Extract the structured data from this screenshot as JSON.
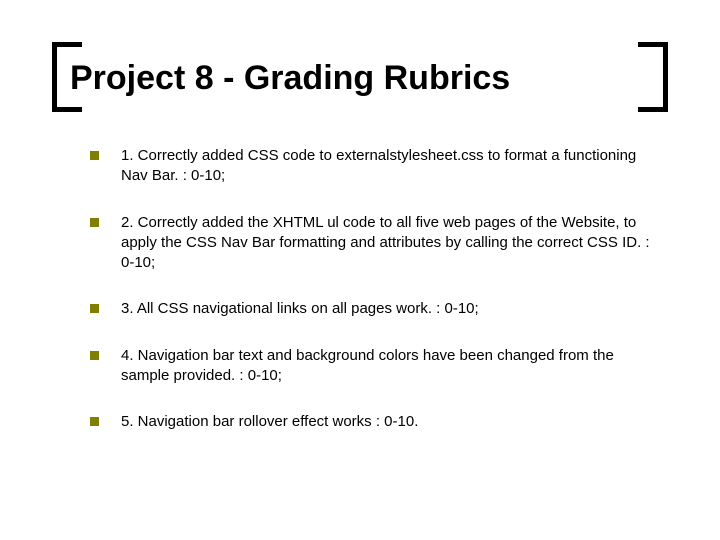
{
  "title": "Project 8 - Grading Rubrics",
  "bullets": [
    {
      "text": "1. Correctly added CSS code to externalstylesheet.css to format a functioning Nav Bar. : 0-10;"
    },
    {
      "text": "2. Correctly added the XHTML ul code to all five web pages of the Website, to apply the CSS Nav Bar formatting and attributes by calling the correct CSS ID. : 0-10;"
    },
    {
      "text": "3. All CSS navigational links on all pages work. : 0-10;"
    },
    {
      "text": "4. Navigation bar text and background colors have been changed from the sample provided. : 0-10;"
    },
    {
      "text": "5. Navigation bar rollover effect works : 0-10."
    }
  ]
}
